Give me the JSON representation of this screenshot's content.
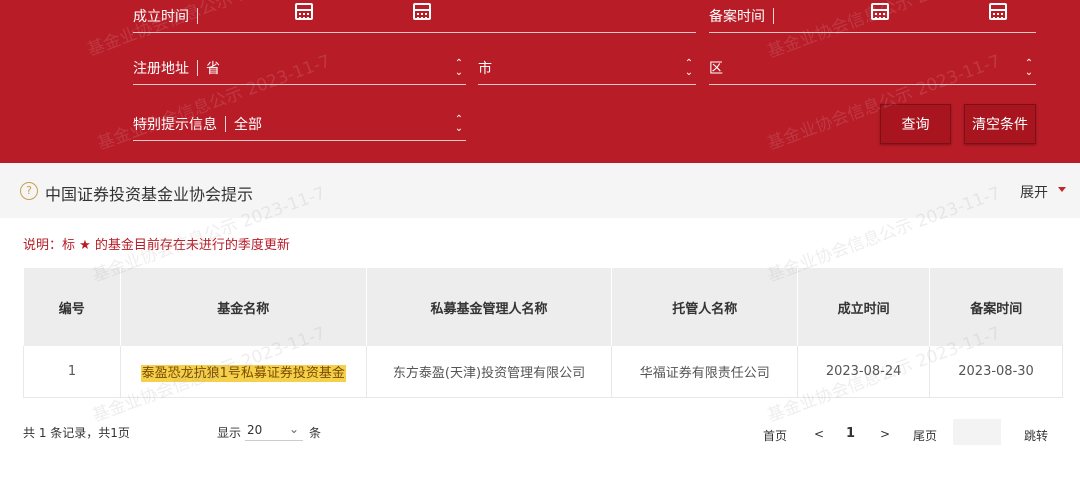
{
  "filter": {
    "row1": {
      "left_label": "成立时间",
      "right_label": "备案时间"
    },
    "row2": {
      "label": "注册地址",
      "province": "省",
      "city": "市",
      "district": "区"
    },
    "row3": {
      "label": "特别提示信息",
      "value": "全部"
    },
    "query_button": "查询",
    "clear_button": "清空条件",
    "color": "#b71c27"
  },
  "notice": {
    "title": "中国证券投资基金业协会提示",
    "expand_label": "展开"
  },
  "note": "说明：标 ★ 的基金目前存在未进行的季度更新",
  "table": {
    "headers": [
      "编号",
      "基金名称",
      "私募基金管理人名称",
      "托管人名称",
      "成立时间",
      "备案时间"
    ],
    "rows": [
      [
        "1",
        "泰盈恐龙抗狼1号私募证券投资基金",
        "东方泰盈(天津)投资管理有限公司",
        "华福证券有限责任公司",
        "2023-08-24",
        "2023-08-30"
      ]
    ]
  },
  "pagination": {
    "summary": "共 1 条记录，共1页",
    "show_label": "显示",
    "page_size": "20",
    "unit": "条",
    "first": "首页",
    "prev": "<",
    "current": "1",
    "next": ">",
    "last": "尾页",
    "jump": "跳转"
  },
  "watermark": "基金业协会信息公示 2023-11-7"
}
